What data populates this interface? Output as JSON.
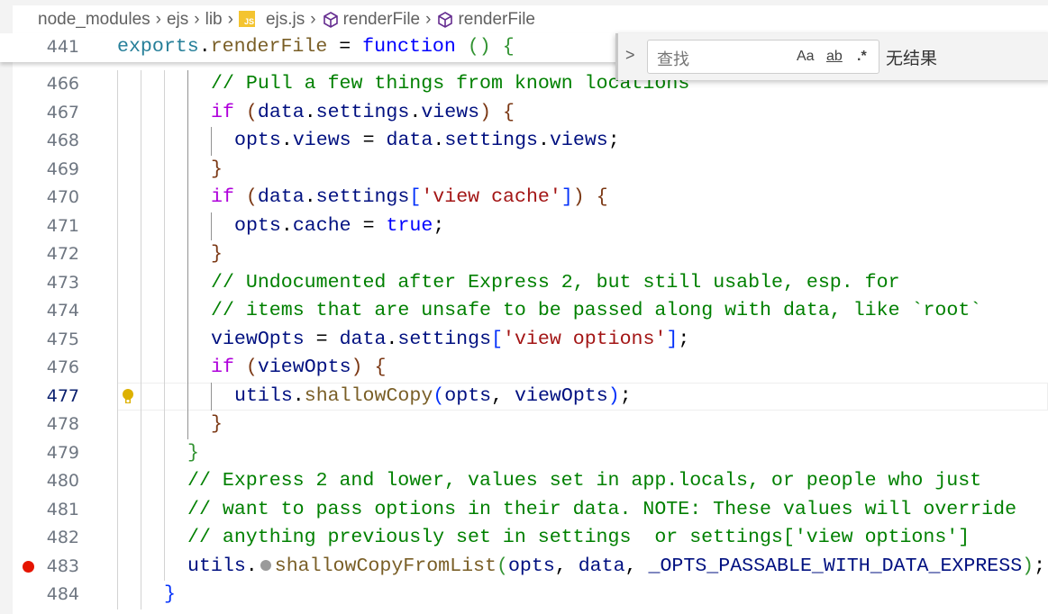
{
  "breadcrumb": [
    {
      "label": "node_modules",
      "icon": null
    },
    {
      "label": "ejs",
      "icon": null
    },
    {
      "label": "lib",
      "icon": null
    },
    {
      "label": "ejs.js",
      "icon": "js-file-icon"
    },
    {
      "label": "renderFile",
      "icon": "method-cube-icon"
    },
    {
      "label": "renderFile",
      "icon": "method-cube-icon"
    }
  ],
  "js_icon_text": "JS",
  "sticky": {
    "num": "441",
    "indent": 0,
    "tokens": [
      [
        "exports",
        "t"
      ],
      [
        ".",
        "p"
      ],
      [
        "renderFile",
        "f"
      ],
      [
        " = ",
        "p"
      ],
      [
        "function",
        "b"
      ],
      [
        " ",
        "p"
      ],
      [
        "()",
        "br2"
      ],
      [
        " ",
        "p"
      ],
      [
        "{",
        "br2"
      ]
    ]
  },
  "find": {
    "placeholder": "查找",
    "match_case": "Aa",
    "whole_word": "ab",
    "regex": ".*",
    "result": "无结果"
  },
  "current_line": "477",
  "breakpoint_line": "483",
  "lightbulb_line": "477",
  "lines": [
    {
      "num": "466",
      "indent": 8,
      "tokens": [
        [
          "// Pull a few things from known locations",
          "c"
        ]
      ]
    },
    {
      "num": "467",
      "indent": 8,
      "tokens": [
        [
          "if",
          "k"
        ],
        [
          " ",
          "p"
        ],
        [
          "(",
          "br3"
        ],
        [
          "data",
          "v"
        ],
        [
          ".",
          "p"
        ],
        [
          "settings",
          "v"
        ],
        [
          ".",
          "p"
        ],
        [
          "views",
          "v"
        ],
        [
          ")",
          "br3"
        ],
        [
          " ",
          "p"
        ],
        [
          "{",
          "br3"
        ]
      ]
    },
    {
      "num": "468",
      "indent": 10,
      "tokens": [
        [
          "opts",
          "v"
        ],
        [
          ".",
          "p"
        ],
        [
          "views",
          "v"
        ],
        [
          " = ",
          "p"
        ],
        [
          "data",
          "v"
        ],
        [
          ".",
          "p"
        ],
        [
          "settings",
          "v"
        ],
        [
          ".",
          "p"
        ],
        [
          "views",
          "v"
        ],
        [
          ";",
          "p"
        ]
      ]
    },
    {
      "num": "469",
      "indent": 8,
      "tokens": [
        [
          "}",
          "br3"
        ]
      ]
    },
    {
      "num": "470",
      "indent": 8,
      "tokens": [
        [
          "if",
          "k"
        ],
        [
          " ",
          "p"
        ],
        [
          "(",
          "br3"
        ],
        [
          "data",
          "v"
        ],
        [
          ".",
          "p"
        ],
        [
          "settings",
          "v"
        ],
        [
          "[",
          "br1"
        ],
        [
          "'view cache'",
          "s"
        ],
        [
          "]",
          "br1"
        ],
        [
          ")",
          "br3"
        ],
        [
          " ",
          "p"
        ],
        [
          "{",
          "br3"
        ]
      ]
    },
    {
      "num": "471",
      "indent": 10,
      "tokens": [
        [
          "opts",
          "v"
        ],
        [
          ".",
          "p"
        ],
        [
          "cache",
          "v"
        ],
        [
          " = ",
          "p"
        ],
        [
          "true",
          "b"
        ],
        [
          ";",
          "p"
        ]
      ]
    },
    {
      "num": "472",
      "indent": 8,
      "tokens": [
        [
          "}",
          "br3"
        ]
      ]
    },
    {
      "num": "473",
      "indent": 8,
      "tokens": [
        [
          "// Undocumented after Express 2, but still usable, esp. for",
          "c"
        ]
      ]
    },
    {
      "num": "474",
      "indent": 8,
      "tokens": [
        [
          "// items that are unsafe to be passed along with data, like `root`",
          "c"
        ]
      ]
    },
    {
      "num": "475",
      "indent": 8,
      "tokens": [
        [
          "viewOpts",
          "v"
        ],
        [
          " = ",
          "p"
        ],
        [
          "data",
          "v"
        ],
        [
          ".",
          "p"
        ],
        [
          "settings",
          "v"
        ],
        [
          "[",
          "br1"
        ],
        [
          "'view options'",
          "s"
        ],
        [
          "]",
          "br1"
        ],
        [
          ";",
          "p"
        ]
      ]
    },
    {
      "num": "476",
      "indent": 8,
      "tokens": [
        [
          "if",
          "k"
        ],
        [
          " ",
          "p"
        ],
        [
          "(",
          "br3"
        ],
        [
          "viewOpts",
          "v"
        ],
        [
          ")",
          "br3"
        ],
        [
          " ",
          "p"
        ],
        [
          "{",
          "br3"
        ]
      ]
    },
    {
      "num": "477",
      "indent": 10,
      "tokens": [
        [
          "utils",
          "v"
        ],
        [
          ".",
          "p"
        ],
        [
          "shallowCopy",
          "f"
        ],
        [
          "(",
          "br1"
        ],
        [
          "opts",
          "v"
        ],
        [
          ", ",
          "p"
        ],
        [
          "viewOpts",
          "v"
        ],
        [
          ")",
          "br1"
        ],
        [
          ";",
          "p"
        ]
      ]
    },
    {
      "num": "478",
      "indent": 8,
      "tokens": [
        [
          "}",
          "br3"
        ]
      ]
    },
    {
      "num": "479",
      "indent": 6,
      "tokens": [
        [
          "}",
          "br2"
        ]
      ]
    },
    {
      "num": "480",
      "indent": 6,
      "tokens": [
        [
          "// Express 2 and lower, values set in app.locals, or people who just",
          "c"
        ]
      ]
    },
    {
      "num": "481",
      "indent": 6,
      "tokens": [
        [
          "// want to pass options in their data. NOTE: These values will override",
          "c"
        ]
      ]
    },
    {
      "num": "482",
      "indent": 6,
      "tokens": [
        [
          "// anything previously set in settings  or settings['view options']",
          "c"
        ]
      ]
    },
    {
      "num": "483",
      "indent": 6,
      "tokens": [
        [
          "utils",
          "v"
        ],
        [
          ".",
          "p"
        ],
        [
          "•",
          "inlay"
        ],
        [
          "shallowCopyFromList",
          "f"
        ],
        [
          "(",
          "br2"
        ],
        [
          "opts",
          "v"
        ],
        [
          ", ",
          "p"
        ],
        [
          "data",
          "v"
        ],
        [
          ", ",
          "p"
        ],
        [
          "_OPTS_PASSABLE_WITH_DATA_EXPRESS",
          "v"
        ],
        [
          ")",
          "br2"
        ],
        [
          ";",
          "p"
        ]
      ]
    },
    {
      "num": "484",
      "indent": 4,
      "tokens": [
        [
          "}",
          "br1"
        ]
      ]
    }
  ]
}
